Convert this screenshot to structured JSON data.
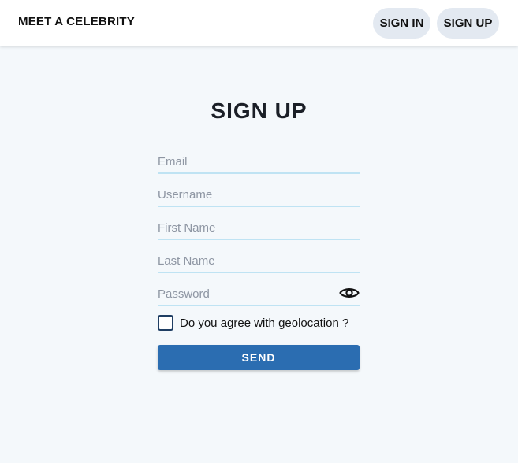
{
  "header": {
    "brand": "MEET A CELEBRITY",
    "sign_in_label": "SIGN IN",
    "sign_up_label": "SIGN UP"
  },
  "form": {
    "title": "SIGN UP",
    "email_placeholder": "Email",
    "username_placeholder": "Username",
    "first_name_placeholder": "First Name",
    "last_name_placeholder": "Last Name",
    "password_placeholder": "Password",
    "password_toggle_icon": "eye-icon",
    "geolocation_label": "Do you agree with geolocation ?",
    "geolocation_checked": false,
    "send_label": "SEND"
  },
  "colors": {
    "page_background": "#f4f8fb",
    "accent": "#2b6db1",
    "field_underline": "#bfe3f3",
    "nav_button_background": "#e3e9f1"
  }
}
